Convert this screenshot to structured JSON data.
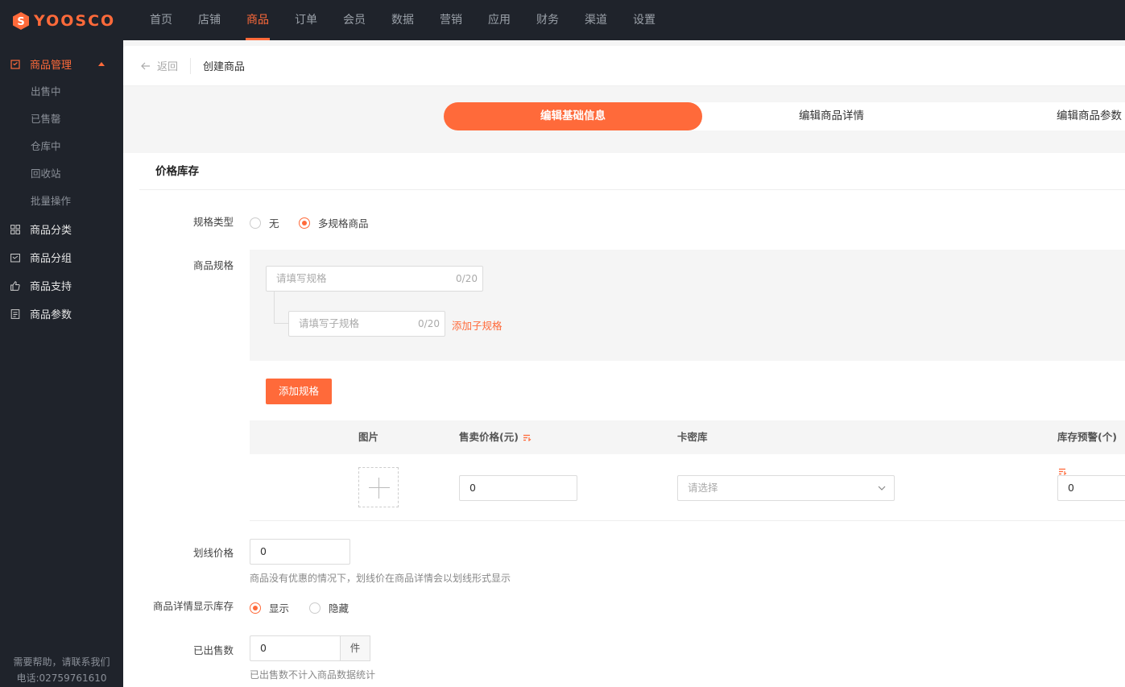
{
  "brand": {
    "name": "YOOSCO",
    "accent": "#ff6a3a",
    "sidebar_bg": "#1f232b"
  },
  "topnav": {
    "items": [
      "首页",
      "店铺",
      "商品",
      "订单",
      "会员",
      "数据",
      "营销",
      "应用",
      "财务",
      "渠道",
      "设置"
    ],
    "active": "商品"
  },
  "sidebar": {
    "group_main": {
      "label": "商品管理",
      "icon": "clipboard-icon"
    },
    "sub_items": [
      "出售中",
      "已售罄",
      "仓库中",
      "回收站",
      "批量操作"
    ],
    "groups": [
      {
        "label": "商品分类",
        "icon": "grid-icon"
      },
      {
        "label": "商品分组",
        "icon": "folder-icon"
      },
      {
        "label": "商品支持",
        "icon": "thumbs-up-icon"
      },
      {
        "label": "商品参数",
        "icon": "document-icon"
      }
    ],
    "help_line1": "需要帮助，请联系我们",
    "help_line2": "电话:02759761610"
  },
  "breadcrumb": {
    "back": "返回",
    "title": "创建商品"
  },
  "steps": [
    "编辑基础信息",
    "编辑商品详情",
    "编辑商品参数"
  ],
  "section": {
    "title": "价格库存"
  },
  "spec_type": {
    "label": "规格类型",
    "options": [
      "无",
      "多规格商品"
    ],
    "selected": "多规格商品"
  },
  "spec": {
    "label": "商品规格",
    "spec_placeholder": "请填写规格",
    "spec_count": "0/20",
    "sub_placeholder": "请填写子规格",
    "sub_count": "0/20",
    "add_sub": "添加子规格",
    "add_spec": "添加规格"
  },
  "table": {
    "headers": [
      "图片",
      "售卖价格(元)",
      "卡密库",
      "库存预警(个)"
    ],
    "row": {
      "price": "0",
      "card_placeholder": "请选择",
      "stock_warn": "0"
    }
  },
  "strike_price": {
    "label": "划线价格",
    "value": "0",
    "hint": "商品没有优惠的情况下，划线价在商品详情会以划线形式显示"
  },
  "show_stock": {
    "label": "商品详情显示库存",
    "options": [
      "显示",
      "隐藏"
    ],
    "selected": "显示"
  },
  "sold": {
    "label": "已出售数",
    "value": "0",
    "unit": "件",
    "hint": "已出售数不计入商品数据统计"
  }
}
